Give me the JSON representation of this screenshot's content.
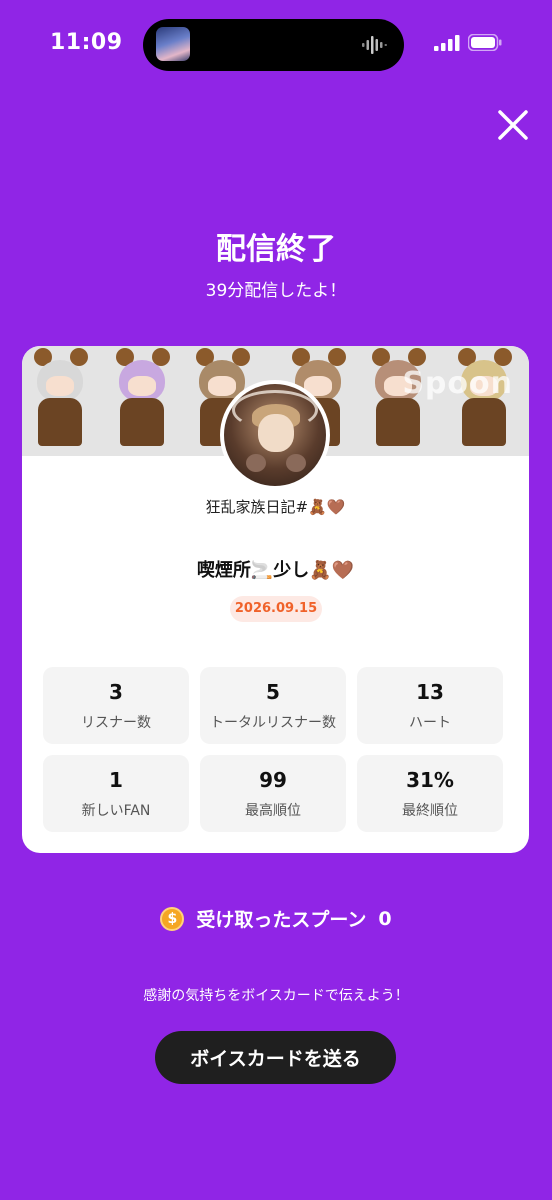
{
  "status_bar": {
    "time": "11:09"
  },
  "header": {
    "title": "配信終了",
    "subtitle": "39分配信したよ！"
  },
  "card": {
    "banner_watermark": "Spoon",
    "username": "狂乱家族日記#🧸🤎",
    "live_title": "喫煙所🚬少し🧸🤎",
    "date": "2026.09.15",
    "stats": [
      {
        "value": "3",
        "label": "リスナー数"
      },
      {
        "value": "5",
        "label": "トータルリスナー数"
      },
      {
        "value": "13",
        "label": "ハート"
      },
      {
        "value": "1",
        "label": "新しいFAN"
      },
      {
        "value": "99",
        "label": "最高順位"
      },
      {
        "value": "31%",
        "label": "最終順位"
      }
    ]
  },
  "spoons": {
    "label": "受け取ったスプーン",
    "count": "0",
    "icon": "coin-icon"
  },
  "thanks_text": "感謝の気持ちをボイスカードで伝えよう！",
  "voice_card_button": "ボイスカードを送る",
  "colors": {
    "background": "#9025e6",
    "date_text": "#f0622a",
    "button": "#1f1f1f"
  }
}
